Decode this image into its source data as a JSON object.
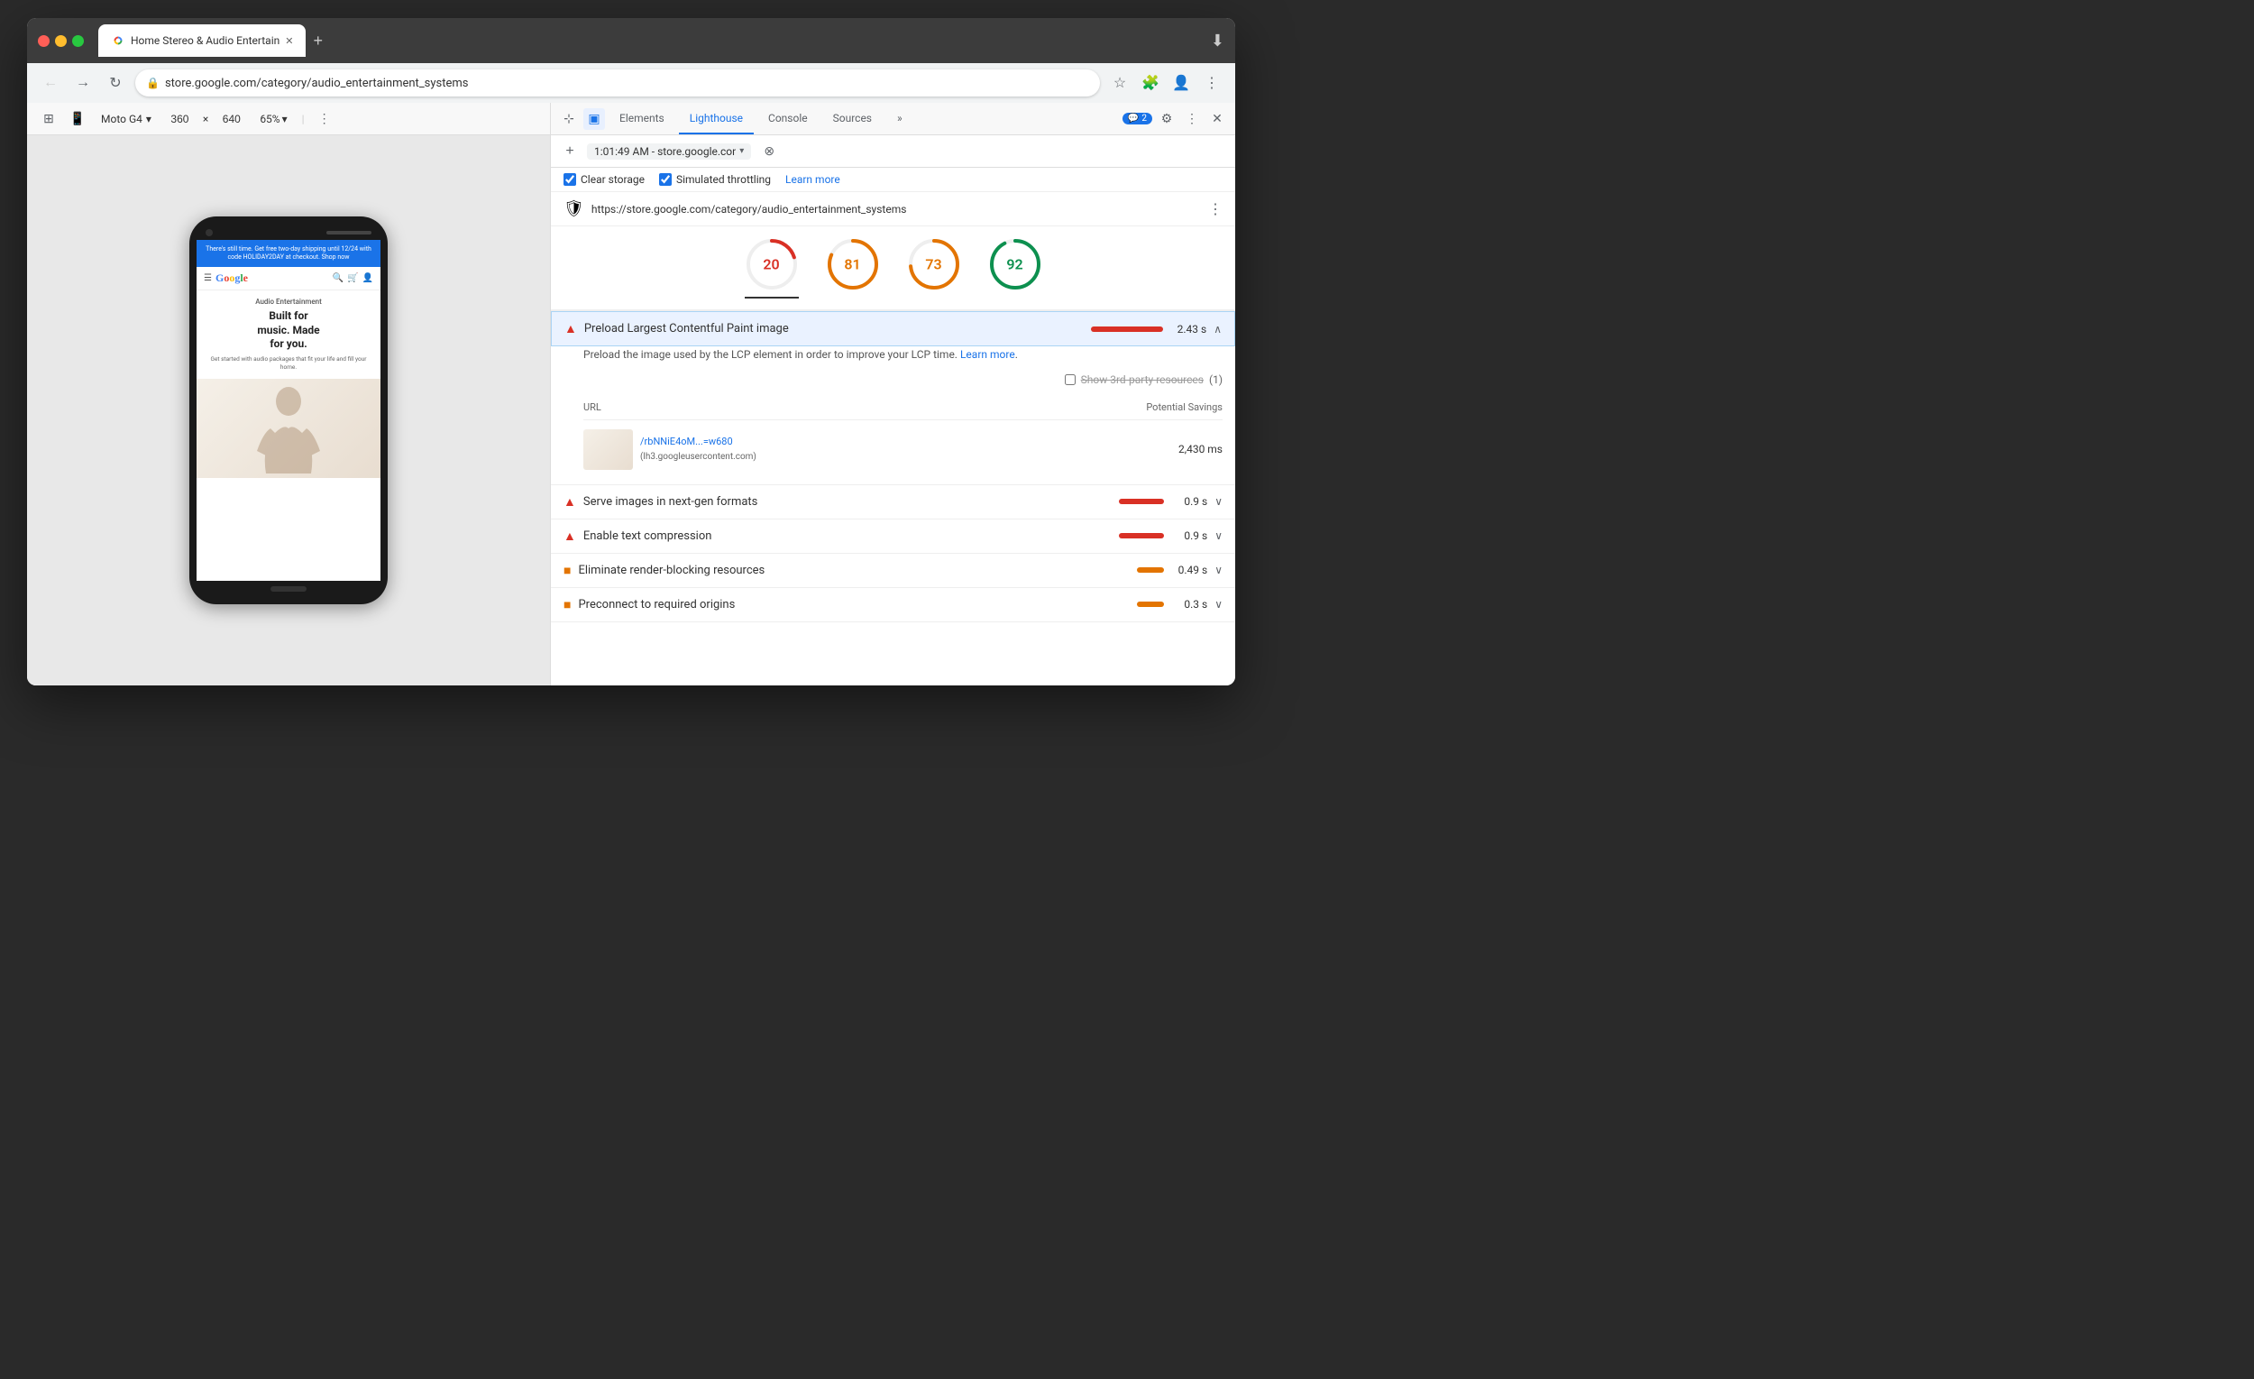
{
  "browser": {
    "tab_title": "Home Stereo & Audio Entertain",
    "tab_favicon": "G",
    "url": "store.google.com/category/audio_entertainment_systems",
    "full_url": "https://store.google.com/category/audio_entertainment_systems"
  },
  "device_toolbar": {
    "device": "Moto G4",
    "width": "360",
    "height_separator": "×",
    "height_dim": "640",
    "zoom": "65%",
    "chevron": "▾"
  },
  "devtools": {
    "tabs": [
      {
        "id": "elements",
        "label": "Elements"
      },
      {
        "id": "lighthouse",
        "label": "Lighthouse"
      },
      {
        "id": "console",
        "label": "Console"
      },
      {
        "id": "sources",
        "label": "Sources"
      }
    ],
    "active_tab": "lighthouse",
    "more_tabs_icon": "»",
    "badge_count": "2",
    "badge_icon": "💬"
  },
  "lighthouse_toolbar": {
    "timestamp": "1:01:49 AM - store.google.cor",
    "chevron": "▾",
    "clear_icon": "⊗"
  },
  "lighthouse_options": {
    "clear_storage_label": "Clear storage",
    "throttling_label": "Simulated throttling",
    "learn_more_link": "Learn more"
  },
  "lighthouse_report": {
    "url_icon": "🔴",
    "url": "https://store.google.com/category/audio_entertainment_systems",
    "scores": [
      {
        "value": 20,
        "color": "#d93025",
        "label": "",
        "circumference": 164,
        "active": true
      },
      {
        "value": 81,
        "color": "#e37400",
        "label": "",
        "circumference": 164
      },
      {
        "value": 73,
        "color": "#e37400",
        "label": "",
        "circumference": 164
      },
      {
        "value": 92,
        "color": "#0d904f",
        "label": "",
        "circumference": 164
      }
    ],
    "audits": [
      {
        "id": "preload-lcp",
        "icon_type": "red",
        "title": "Preload Largest Contentful Paint image",
        "bar_type": "red",
        "time": "2.43 s",
        "expanded": true,
        "description": "Preload the image used by the LCP element in order to improve your LCP time.",
        "learn_more_text": "Learn more",
        "third_party_label": "Show 3rd-party resources",
        "third_party_count": "(1)",
        "table_headers": {
          "url_col": "URL",
          "savings_col": "Potential Savings"
        },
        "table_rows": [
          {
            "url_path": "/rbNNiE4oM...=w680",
            "url_source": "(lh3.googleusercontent.com)",
            "savings": "2,430 ms",
            "has_thumbnail": true
          }
        ]
      },
      {
        "id": "next-gen-formats",
        "icon_type": "red",
        "title": "Serve images in next-gen formats",
        "bar_type": "red-short",
        "time": "0.9 s",
        "expanded": false
      },
      {
        "id": "text-compression",
        "icon_type": "red",
        "title": "Enable text compression",
        "bar_type": "red-short",
        "time": "0.9 s",
        "expanded": false
      },
      {
        "id": "render-blocking",
        "icon_type": "orange",
        "title": "Eliminate render-blocking resources",
        "bar_type": "orange-short",
        "time": "0.49 s",
        "expanded": false
      },
      {
        "id": "preconnect",
        "icon_type": "orange",
        "title": "Preconnect to required origins",
        "bar_type": "orange-short",
        "time": "0.3 s",
        "expanded": false
      }
    ]
  },
  "mobile_content": {
    "banner_text": "There's still time. Get free two-day shipping until 12/24 with code HOLIDAY2DAY at checkout. Shop now",
    "hero_category": "Audio Entertainment",
    "hero_headline_line1": "Built for",
    "hero_headline_line2": "music. Made",
    "hero_headline_line3": "for you.",
    "hero_sub": "Get started with audio packages that fit your life and fill your home."
  }
}
